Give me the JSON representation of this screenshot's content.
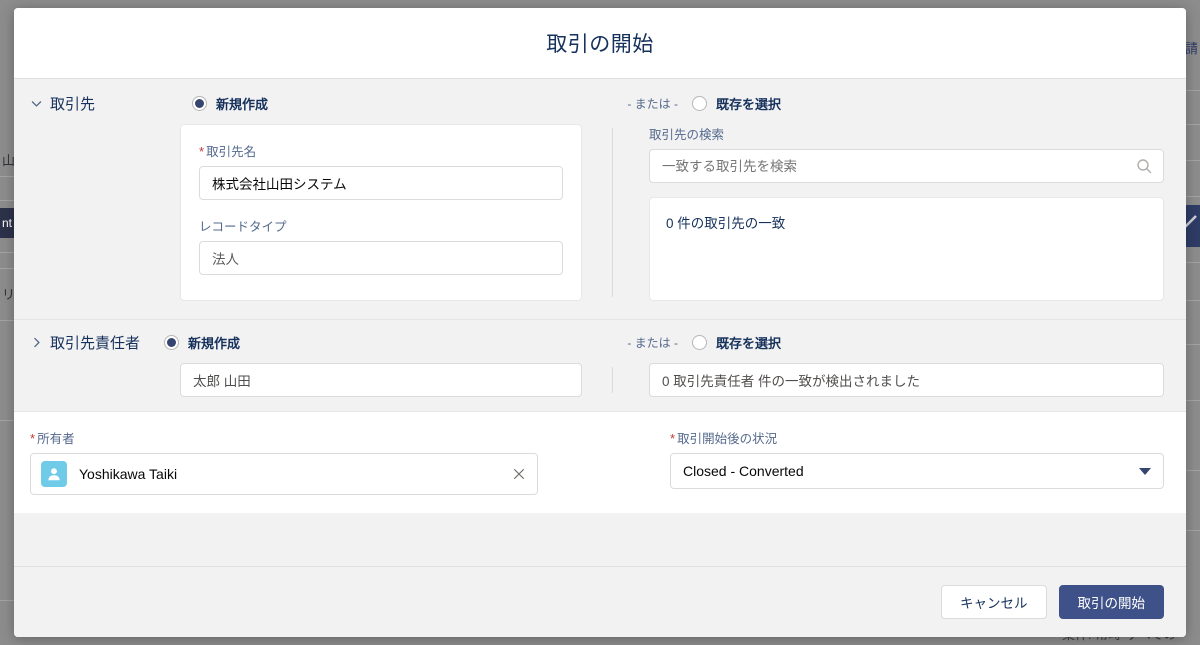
{
  "background": {
    "left_snippets": [
      "山",
      "リ:"
    ],
    "left_chip": "nt",
    "right_snippet": "請",
    "bottom_text": "案件: 常時・すべての"
  },
  "modal": {
    "title": "取引の開始",
    "account_section": {
      "label": "取引先",
      "expanded": true,
      "chevron_icon": "chevron-down-icon",
      "new_radio": {
        "label": "新規作成",
        "checked": true
      },
      "or_label": "- または -",
      "existing_radio": {
        "label": "既存を選択",
        "checked": false
      },
      "account_name": {
        "label": "取引先名",
        "required": true,
        "value": "株式会社山田システム"
      },
      "record_type": {
        "label": "レコードタイプ",
        "required": false,
        "value": "法人"
      },
      "search": {
        "label": "取引先の検索",
        "placeholder": "一致する取引先を検索",
        "value": "",
        "icon": "search-icon"
      },
      "results_text": "0 件の取引先の一致"
    },
    "contact_section": {
      "label": "取引先責任者",
      "expanded": false,
      "chevron_icon": "chevron-right-icon",
      "new_radio": {
        "label": "新規作成",
        "checked": true
      },
      "or_label": "- または -",
      "existing_radio": {
        "label": "既存を選択",
        "checked": false
      },
      "contact_name_value": "太郎 山田",
      "matches_text": "0 取引先責任者 件の一致が検出されました"
    },
    "owner_field": {
      "label": "所有者",
      "required": true,
      "value": "Yoshikawa Taiki",
      "avatar_icon": "user-avatar-icon",
      "clear_icon": "close-icon"
    },
    "status_field": {
      "label": "取引開始後の状況",
      "required": true,
      "value": "Closed - Converted",
      "caret_icon": "chevron-down-icon"
    },
    "footer": {
      "cancel_label": "キャンセル",
      "submit_label": "取引の開始"
    }
  },
  "colors": {
    "brand_navy": "#3f5189",
    "radio_fill": "#35456f",
    "required_red": "#c23934",
    "avatar_blue": "#6fcbe8",
    "panel_gray": "#f3f2f2"
  }
}
